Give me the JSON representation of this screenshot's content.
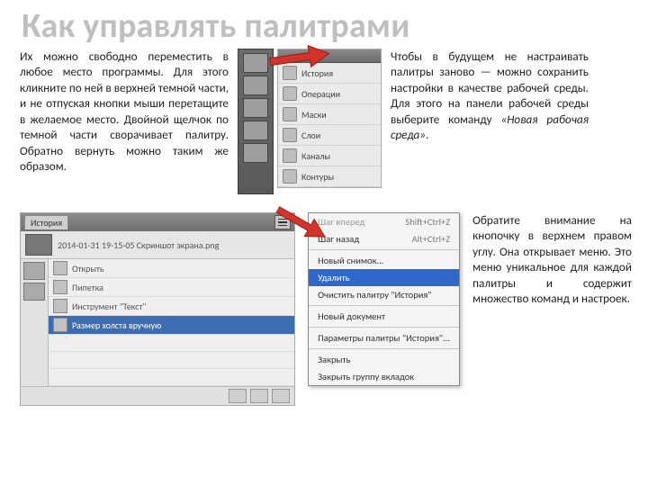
{
  "title": "Как управлять палитрами",
  "para_left": "Их можно свободно переместить в любое место программы. Для этого кликните по ней в верхней темной части, и не отпуская кнопки мыши перетащите в желаемое место.\nДвойной щелчок по темной части сворачивает палитру. Обратно вернуть можно таким же образом.",
  "para_top_right": "Чтобы в будущем не настраивать палитры заново — можно сохранить настройки в качестве рабочей среды. Для этого на панели рабочей среды выберите команду ",
  "para_top_right_italic": "«Новая рабочая среда»",
  "para_top_right_end": ".",
  "para_bottom_right": "Обратите внимание на кнопочку в верхнем правом углу. Она открывает меню. Это меню уникальное для каждой палитры и содержит множество команд и настроек.",
  "dock_items": [
    "История",
    "Операции",
    "Маски",
    "Слои",
    "Каналы",
    "Контуры"
  ],
  "history": {
    "tab": "История",
    "file": "2014-01-31 19-15-05 Скриншот экрана.png",
    "entries": [
      "Открыть",
      "Пипетка",
      "Инструмент \"Текст\"",
      "Размер холста вручную"
    ]
  },
  "menu": {
    "items": [
      {
        "label": "Шаг вперед",
        "shortcut": "Shift+Ctrl+Z",
        "state": "dis"
      },
      {
        "label": "Шаг назад",
        "shortcut": "Alt+Ctrl+Z",
        "state": ""
      },
      {
        "sep": true
      },
      {
        "label": "Новый снимок...",
        "state": ""
      },
      {
        "label": "Удалить",
        "state": "sel"
      },
      {
        "label": "Очистить палитру \"История\"",
        "state": ""
      },
      {
        "sep": true
      },
      {
        "label": "Новый документ",
        "state": ""
      },
      {
        "sep": true
      },
      {
        "label": "Параметры палитры \"История\"...",
        "state": ""
      },
      {
        "sep": true
      },
      {
        "label": "Закрыть",
        "state": ""
      },
      {
        "label": "Закрыть группу вкладок",
        "state": ""
      }
    ]
  }
}
